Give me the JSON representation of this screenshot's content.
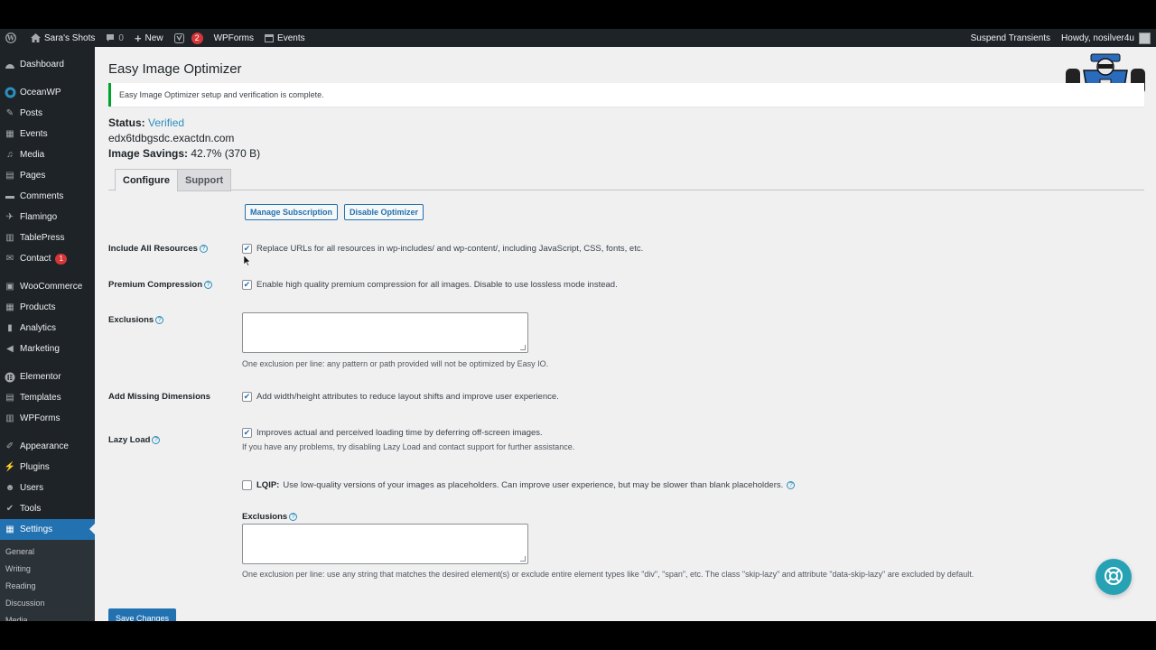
{
  "admin_bar": {
    "site_name": "Sara's Shots",
    "comments_count": "0",
    "new_label": "New",
    "yoast_badge": "2",
    "wpforms_label": "WPForms",
    "events_label": "Events",
    "suspend_transients": "Suspend Transients",
    "howdy": "Howdy, nosilver4u"
  },
  "sidebar": {
    "items": [
      {
        "label": "Dashboard",
        "icon": "dashboard-icon"
      },
      {
        "label": "OceanWP",
        "icon": "oceanwp-icon"
      },
      {
        "label": "Posts",
        "icon": "pin-icon"
      },
      {
        "label": "Events",
        "icon": "calendar-icon"
      },
      {
        "label": "Media",
        "icon": "media-icon"
      },
      {
        "label": "Pages",
        "icon": "page-icon"
      },
      {
        "label": "Comments",
        "icon": "comment-icon"
      },
      {
        "label": "Flamingo",
        "icon": "flamingo-icon"
      },
      {
        "label": "TablePress",
        "icon": "table-icon"
      },
      {
        "label": "Contact",
        "icon": "mail-icon",
        "badge": "1"
      },
      {
        "label": "WooCommerce",
        "icon": "woocommerce-icon"
      },
      {
        "label": "Products",
        "icon": "products-icon"
      },
      {
        "label": "Analytics",
        "icon": "analytics-icon"
      },
      {
        "label": "Marketing",
        "icon": "megaphone-icon"
      },
      {
        "label": "Elementor",
        "icon": "elementor-icon"
      },
      {
        "label": "Templates",
        "icon": "templates-icon"
      },
      {
        "label": "WPForms",
        "icon": "forms-icon"
      },
      {
        "label": "Appearance",
        "icon": "brush-icon"
      },
      {
        "label": "Plugins",
        "icon": "plugin-icon"
      },
      {
        "label": "Users",
        "icon": "users-icon"
      },
      {
        "label": "Tools",
        "icon": "wrench-icon"
      },
      {
        "label": "Settings",
        "icon": "settings-icon"
      }
    ],
    "submenu": [
      "General",
      "Writing",
      "Reading",
      "Discussion",
      "Media"
    ]
  },
  "page": {
    "title": "Easy Image Optimizer",
    "notice": "Easy Image Optimizer setup and verification is complete.",
    "status_label": "Status:",
    "status_value": "Verified",
    "domain": "edx6tdbgsdc.exactdn.com",
    "savings_label": "Image Savings:",
    "savings_value": "42.7% (370 B)",
    "tabs": [
      "Configure",
      "Support"
    ],
    "manage_subscription": "Manage Subscription",
    "disable_optimizer": "Disable Optimizer",
    "save_changes": "Save Changes"
  },
  "settings": {
    "include_all": {
      "label": "Include All Resources",
      "text": "Replace URLs for all resources in wp-includes/ and wp-content/, including JavaScript, CSS, fonts, etc.",
      "checked": true
    },
    "premium": {
      "label": "Premium Compression",
      "text": "Enable high quality premium compression for all images. Disable to use lossless mode instead.",
      "checked": true
    },
    "exclusions": {
      "label": "Exclusions",
      "value": "",
      "desc": "One exclusion per line: any pattern or path provided will not be optimized by Easy IO."
    },
    "dimensions": {
      "label": "Add Missing Dimensions",
      "text": "Add width/height attributes to reduce layout shifts and improve user experience.",
      "checked": true
    },
    "lazy_load": {
      "label": "Lazy Load",
      "text": "Improves actual and perceived loading time by deferring off-screen images.",
      "desc": "If you have any problems, try disabling Lazy Load and contact support for further assistance.",
      "checked": true
    },
    "lqip": {
      "label": "LQIP:",
      "text": "Use low-quality versions of your images as placeholders. Can improve user experience, but may be slower than blank placeholders.",
      "checked": false
    },
    "lazy_exclusions": {
      "label": "Exclusions",
      "value": "",
      "desc": "One exclusion per line: use any string that matches the desired element(s) or exclude entire element types like \"div\", \"span\", etc. The class \"skip-lazy\" and attribute \"data-skip-lazy\" are excluded by default."
    }
  },
  "colors": {
    "accent": "#2271b1",
    "verified": "#2b8fbd",
    "sidebar_bg": "#1d2327",
    "notice_border": "#00a32a",
    "beacon": "#27a2b5"
  }
}
